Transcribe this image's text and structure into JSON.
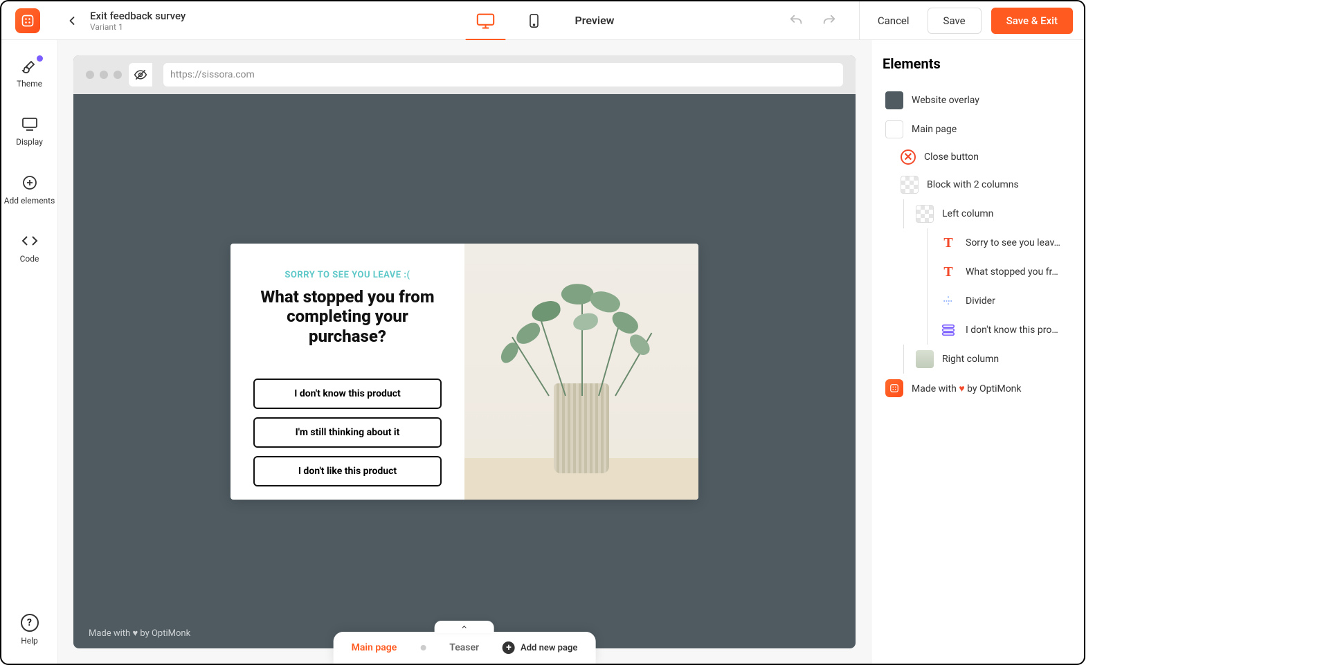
{
  "header": {
    "title": "Exit feedback survey",
    "variant": "Variant 1",
    "preview": "Preview",
    "cancel": "Cancel",
    "save": "Save",
    "save_exit": "Save & Exit"
  },
  "left_sidebar": {
    "theme": "Theme",
    "display": "Display",
    "add_elements": "Add elements",
    "code": "Code",
    "help": "Help"
  },
  "canvas": {
    "url": "https://sissora.com",
    "popup": {
      "sorry": "SORRY TO SEE YOU LEAVE :(",
      "headline": "What stopped you from completing your purchase?",
      "option1": "I don't know this product",
      "option2": "I'm still thinking about it",
      "option3": "I don't like this product"
    },
    "madewith": "Made with ♥ by OptiMonk"
  },
  "pager": {
    "main_page": "Main page",
    "teaser": "Teaser",
    "add_new": "Add new page"
  },
  "elements_panel": {
    "title": "Elements",
    "overlay": "Website overlay",
    "main_page": "Main page",
    "close_button": "Close button",
    "block_2col": "Block with 2 columns",
    "left_col": "Left column",
    "sorry_text": "Sorry to see you leav…",
    "what_stopped": "What stopped you fr…",
    "divider": "Divider",
    "idk_product": "I don't know this pro…",
    "right_col": "Right column",
    "madewith_prefix": "Made with ",
    "madewith_suffix": " by OptiMonk"
  }
}
